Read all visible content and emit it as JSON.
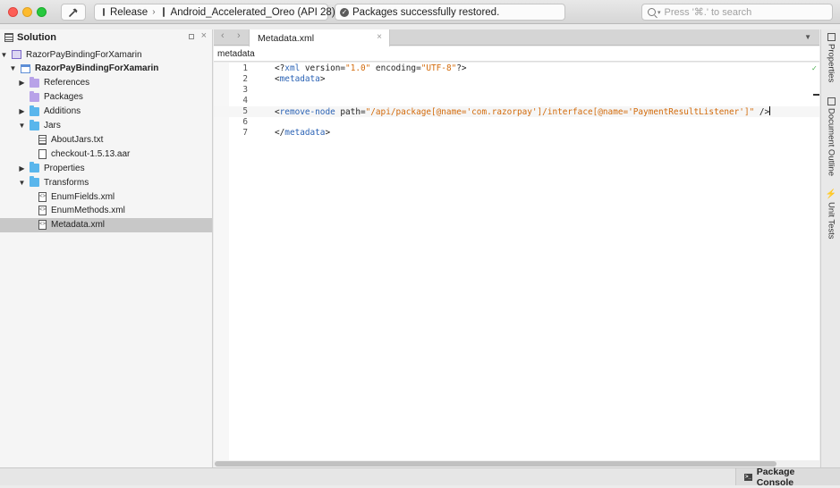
{
  "toolbar": {
    "config": "Release",
    "device": "Android_Accelerated_Oreo (API 28)",
    "status_message": "Packages successfully restored.",
    "search_placeholder": "Press '⌘.' to search"
  },
  "solution": {
    "title": "Solution",
    "items": [
      {
        "label": "RazorPayBindingForXamarin",
        "expand": "▼",
        "icon": "solution-icon",
        "depth": 0,
        "bold": false
      },
      {
        "label": "RazorPayBindingForXamarin",
        "expand": "▼",
        "icon": "project-icon",
        "depth": 1,
        "bold": true
      },
      {
        "label": "References",
        "expand": "▶",
        "icon": "references-folder-icon",
        "depth": 2,
        "bold": false
      },
      {
        "label": "Packages",
        "expand": "",
        "icon": "packages-folder-icon",
        "depth": 2,
        "bold": false
      },
      {
        "label": "Additions",
        "expand": "▶",
        "icon": "folder-icon",
        "depth": 2,
        "bold": false
      },
      {
        "label": "Jars",
        "expand": "▼",
        "icon": "folder-icon",
        "depth": 2,
        "bold": false
      },
      {
        "label": "AboutJars.txt",
        "expand": "",
        "icon": "text-file-icon",
        "depth": 3,
        "bold": false
      },
      {
        "label": "checkout-1.5.13.aar",
        "expand": "",
        "icon": "file-icon",
        "depth": 3,
        "bold": false
      },
      {
        "label": "Properties",
        "expand": "▶",
        "icon": "folder-icon",
        "depth": 2,
        "bold": false
      },
      {
        "label": "Transforms",
        "expand": "▼",
        "icon": "folder-icon",
        "depth": 2,
        "bold": false
      },
      {
        "label": "EnumFields.xml",
        "expand": "",
        "icon": "xml-file-icon",
        "depth": 3,
        "bold": false
      },
      {
        "label": "EnumMethods.xml",
        "expand": "",
        "icon": "xml-file-icon",
        "depth": 3,
        "bold": false
      },
      {
        "label": "Metadata.xml",
        "expand": "",
        "icon": "xml-file-icon",
        "depth": 3,
        "bold": false,
        "selected": true
      }
    ]
  },
  "editor": {
    "tab_label": "Metadata.xml",
    "tab_close": "×",
    "path": "metadata",
    "current_line": 5,
    "lines": [
      {
        "num": "1",
        "tokens": [
          [
            "p",
            "<?"
          ],
          [
            "tag",
            "xml"
          ],
          [
            "p",
            " version="
          ],
          [
            "str",
            "\"1.0\""
          ],
          [
            "p",
            " encoding="
          ],
          [
            "str",
            "\"UTF-8\""
          ],
          [
            "p",
            "?>"
          ]
        ]
      },
      {
        "num": "2",
        "tokens": [
          [
            "p",
            "<"
          ],
          [
            "tag",
            "metadata"
          ],
          [
            "p",
            ">"
          ]
        ]
      },
      {
        "num": "3",
        "tokens": []
      },
      {
        "num": "4",
        "tokens": []
      },
      {
        "num": "5",
        "tokens": [
          [
            "p",
            "<"
          ],
          [
            "tag",
            "remove-node"
          ],
          [
            "p",
            " path="
          ],
          [
            "str",
            "\"/api/package[@name='com.razorpay']/interface[@name='PaymentResultListener']\""
          ],
          [
            "p",
            " />"
          ]
        ]
      },
      {
        "num": "6",
        "tokens": []
      },
      {
        "num": "7",
        "tokens": [
          [
            "p",
            "</"
          ],
          [
            "tag",
            "metadata"
          ],
          [
            "p",
            ">"
          ]
        ]
      }
    ]
  },
  "right_dock": {
    "items": [
      "Properties",
      "Document Outline",
      "Unit Tests"
    ]
  },
  "statusbar": {
    "package_console": "Package Console"
  },
  "colors": {
    "tag": "#2b63b5",
    "string": "#d36b0b",
    "selection": "#c8c8c8"
  }
}
